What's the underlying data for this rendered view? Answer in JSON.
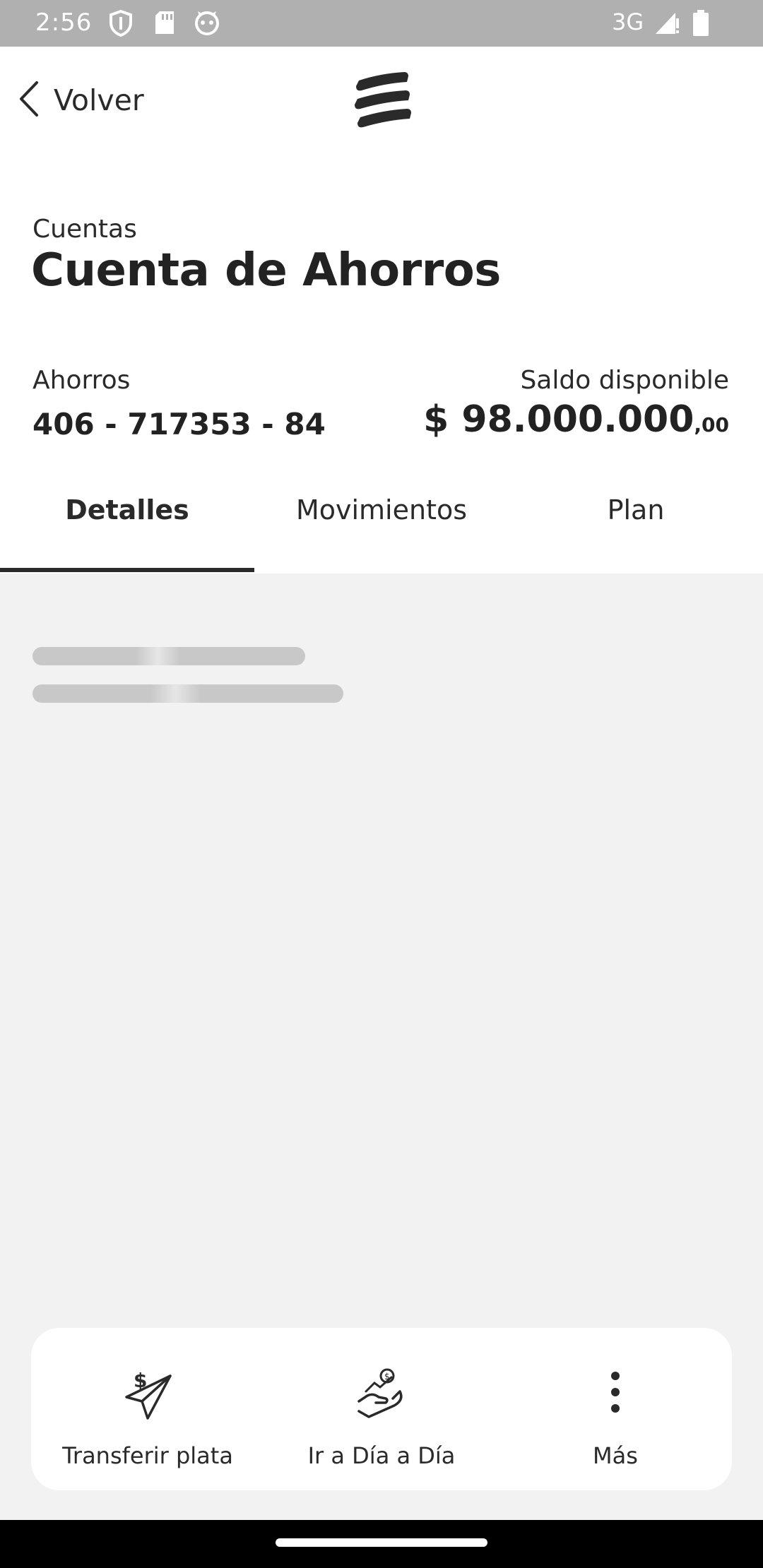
{
  "status_bar": {
    "time": "2:56",
    "network": "3G",
    "icons": [
      "shield-icon",
      "sd-card-icon",
      "cat-face-icon",
      "signal-icon",
      "battery-icon"
    ]
  },
  "header": {
    "back_label": "Volver",
    "icons": [
      "chevron-left-icon",
      "brand-logo"
    ]
  },
  "page": {
    "breadcrumb": "Cuentas",
    "title": "Cuenta de Ahorros"
  },
  "account": {
    "type": "Ahorros",
    "number": "406 - 717353 - 84",
    "balance_label": "Saldo disponible",
    "balance_main": "$ 98.000.000",
    "balance_cents": ",00"
  },
  "tabs": [
    {
      "label": "Detalles",
      "active": true
    },
    {
      "label": "Movimientos",
      "active": false
    },
    {
      "label": "Plan",
      "active": false
    }
  ],
  "actions": [
    {
      "label": "Transferir plata",
      "icon": "send-money-icon"
    },
    {
      "label": "Ir a Día a Día",
      "icon": "hand-money-icon"
    },
    {
      "label": "Más",
      "icon": "more-vertical-icon"
    }
  ],
  "colors": {
    "status_bar": "#b0b0b0",
    "text": "#222222",
    "content_bg": "#f2f2f2",
    "tab_indicator": "#2a2a2a",
    "skeleton": "#c8c8c8"
  }
}
